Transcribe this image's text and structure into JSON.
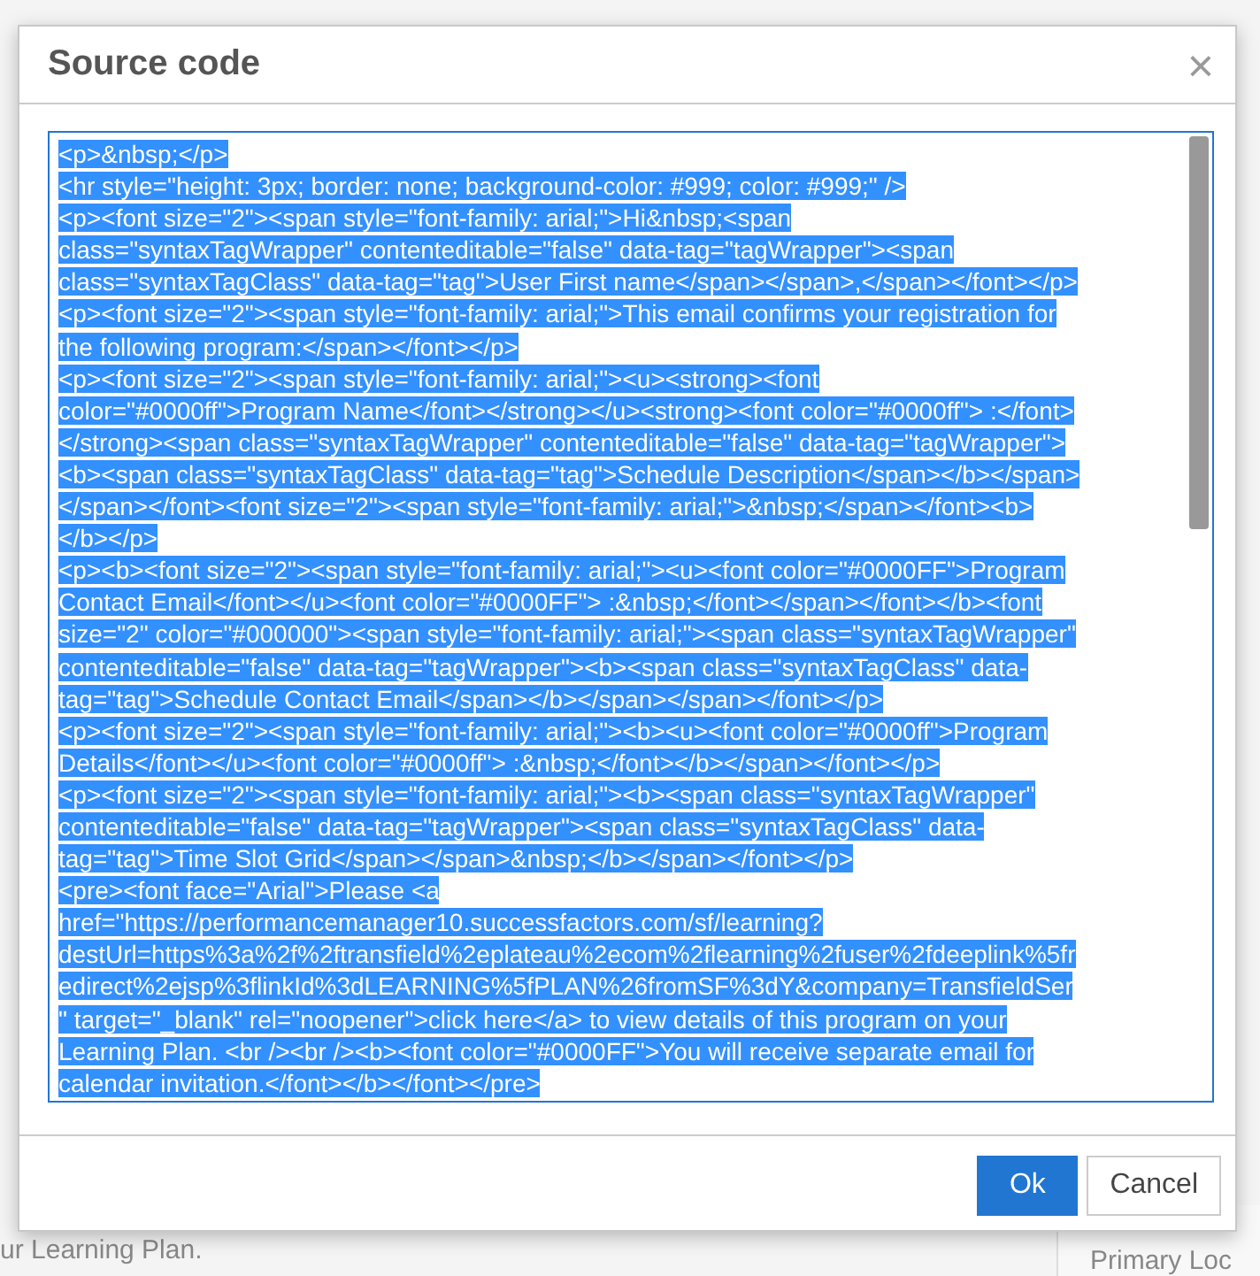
{
  "background": {
    "left_text": "ur Learning Plan.",
    "right_text": "Primary Loc"
  },
  "dialog": {
    "title": "Source code",
    "close": "×",
    "source_lines": [
      "<p>&nbsp;</p>",
      "<hr style=\"height: 3px; border: none; background-color: #999; color: #999;\" />",
      "<p><font size=\"2\"><span style=\"font-family: arial;\">Hi&nbsp;<span",
      "class=\"syntaxTagWrapper\" contenteditable=\"false\" data-tag=\"tagWrapper\"><span",
      "class=\"syntaxTagClass\" data-tag=\"tag\">User First name</span></span>,</span></font></p>",
      "<p><font size=\"2\"><span style=\"font-family: arial;\">This email confirms your registration for",
      "the following program:</span></font></p>",
      "<p><font size=\"2\"><span style=\"font-family: arial;\"><u><strong><font",
      "color=\"#0000ff\">Program Name</font></strong></u><strong><font color=\"#0000ff\"> :</font>",
      "</strong><span class=\"syntaxTagWrapper\" contenteditable=\"false\" data-tag=\"tagWrapper\">",
      "<b><span class=\"syntaxTagClass\" data-tag=\"tag\">Schedule Description</span></b></span>",
      "</span></font><font size=\"2\"><span style=\"font-family: arial;\">&nbsp;</span></font><b>",
      "</b></p>",
      "<p><b><font size=\"2\"><span style=\"font-family: arial;\"><u><font color=\"#0000FF\">Program",
      "Contact Email</font></u><font color=\"#0000FF\"> :&nbsp;</font></span></font></b><font",
      "size=\"2\" color=\"#000000\"><span style=\"font-family: arial;\"><span class=\"syntaxTagWrapper\"",
      "contenteditable=\"false\" data-tag=\"tagWrapper\"><b><span class=\"syntaxTagClass\" data-",
      "tag=\"tag\">Schedule Contact Email</span></b></span></span></font></p>",
      "<p><font size=\"2\"><span style=\"font-family: arial;\"><b><u><font color=\"#0000ff\">Program",
      "Details</font></u><font color=\"#0000ff\"> :&nbsp;</font></b></span></font></p>",
      "<p><font size=\"2\"><span style=\"font-family: arial;\"><b><span class=\"syntaxTagWrapper\"",
      "contenteditable=\"false\" data-tag=\"tagWrapper\"><span class=\"syntaxTagClass\" data-",
      "tag=\"tag\">Time Slot Grid</span></span>&nbsp;</b></span></font></p>",
      "<pre><font face=\"Arial\">Please <a",
      "href=\"https://performancemanager10.successfactors.com/sf/learning?",
      "destUrl=https%3a%2f%2ftransfield%2eplateau%2ecom%2flearning%2fuser%2fdeeplink%5fr",
      "edirect%2ejsp%3flinkId%3dLEARNING%5fPLAN%26fromSF%3dY&company=TransfieldSer",
      "\" target=\"_blank\" rel=\"noopener\">click here</a> to view details of this program on your",
      "Learning Plan. <br /><br /><b><font color=\"#0000FF\">You will receive separate email for",
      "calendar invitation.</font></b></font></pre>"
    ],
    "buttons": [
      {
        "label": "Ok",
        "kind": "primary"
      },
      {
        "label": "Cancel",
        "kind": "secondary"
      }
    ]
  }
}
